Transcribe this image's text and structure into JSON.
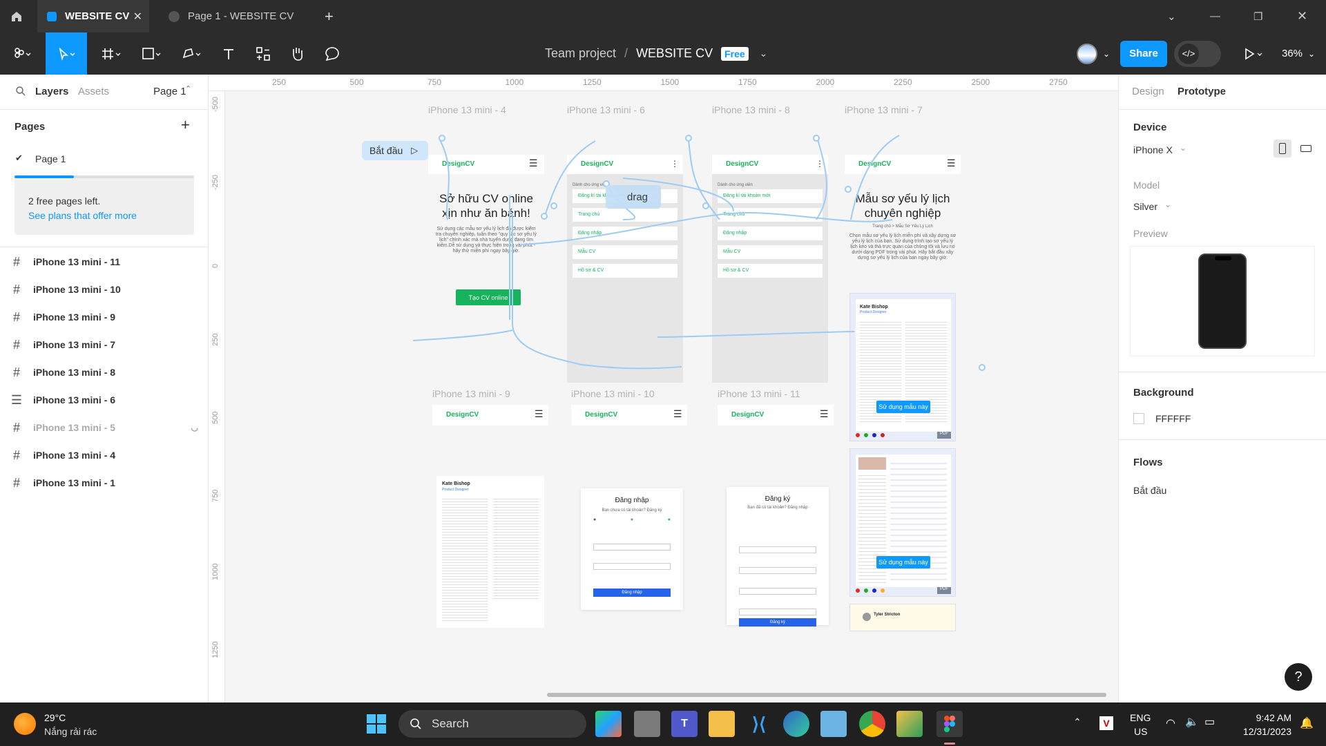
{
  "tabs": {
    "active": "WEBSITE CV",
    "inactive": "Page 1 - WEBSITE CV"
  },
  "toolbar": {
    "team": "Team project",
    "separator": "/",
    "file": "WEBSITE CV",
    "badge": "Free",
    "share": "Share",
    "zoom": "36%"
  },
  "left": {
    "tab_layers": "Layers",
    "tab_assets": "Assets",
    "page_select": "Page 1",
    "pages_title": "Pages",
    "page1": "Page 1",
    "notice": "2 free pages left.",
    "notice_link": "See plans that offer more",
    "layers": [
      "iPhone 13 mini - 11",
      "iPhone 13 mini - 10",
      "iPhone 13 mini - 9",
      "iPhone 13 mini - 7",
      "iPhone 13 mini - 8",
      "iPhone 13 mini - 6",
      "iPhone 13 mini - 5",
      "iPhone 13 mini - 4",
      "iPhone 13 mini - 1"
    ]
  },
  "ruler": {
    "h": [
      "250",
      "500",
      "750",
      "1000",
      "1250",
      "1500",
      "1750",
      "2000",
      "2250",
      "2500",
      "2750"
    ],
    "v": [
      "-500",
      "-250",
      "0",
      "250",
      "500",
      "750",
      "1000",
      "1250"
    ]
  },
  "canvas": {
    "flow_start": "Bắt đầu",
    "drag_label": "drag",
    "frames": {
      "f4": "iPhone 13 mini - 4",
      "f6": "iPhone 13 mini - 6",
      "f8": "iPhone 13 mini - 8",
      "f7": "iPhone 13 mini - 7",
      "f9": "iPhone 13 mini - 9",
      "f10": "iPhone 13 mini - 10",
      "f11": "iPhone 13 mini - 11"
    },
    "logo": "DesignCV",
    "hero_title_1": "Sở hữu CV online",
    "hero_title_2": "xịn như ăn bánh!",
    "hero_desc": "Sử dụng các mẫu sơ yếu lý lịch đã được kiểm tra chuyên nghiệp, tuân theo \"quy tắc sơ yếu lý lịch\" chính xác mà nhà tuyển dụng đang tìm kiếm.Dễ sử dụng và thực hiện trong vài phút - hãy thử miễn phí ngay bây giờ.",
    "hero_cta": "Tạo CV online",
    "menu_for": "Dành cho ứng viên",
    "menu_items": [
      "Đăng kí tài khoản mới",
      "Trang chủ",
      "Đăng nhập",
      "Mẫu CV",
      "Hồ sơ & CV"
    ],
    "tpl_title_1": "Mẫu sơ yếu lý lịch",
    "tpl_title_2": "chuyên nghiệp",
    "tpl_crumb": "Trang chủ > Mẫu Sơ Yếu Lý Lịch",
    "tpl_desc": "Chọn mẫu sơ yếu lý lịch miễn phí và xây dựng sơ yếu lý lịch của bạn. Sử dụng trình tạo sơ yếu lý lịch kéo và thả trực quan của chúng tôi và lưu nó dưới dạng PDF trong vài phút. Hãy bắt đầu xây dựng sơ yếu lý lịch của bạn ngay bây giờ.",
    "use_template": "Sử dụng mẫu này",
    "pdf": "PDF",
    "cv_name": "Kate Bishop",
    "cv_role": "Product Designer",
    "cv_name2": "Tyler Stricton",
    "login_title": "Đăng nhập",
    "login_sub": "Bạn chưa có tài khoản? Đăng ký",
    "login_btn": "Đăng nhập",
    "register_title": "Đăng ký",
    "register_sub": "Bạn đã có tài khoản? Đăng nhập",
    "register_btn": "Đăng ký"
  },
  "right": {
    "tab_design": "Design",
    "tab_prototype": "Prototype",
    "device_title": "Device",
    "device": "iPhone X",
    "model_label": "Model",
    "model": "Silver",
    "preview_label": "Preview",
    "bg_title": "Background",
    "bg_value": "FFFFFF",
    "flows_title": "Flows",
    "flow": "Bắt đầu"
  },
  "taskbar": {
    "temp": "29°C",
    "weather": "Nắng rải rác",
    "search": "Search",
    "lang1": "ENG",
    "lang2": "US",
    "time": "9:42 AM",
    "date": "12/31/2023"
  },
  "colors": {
    "accent": "#0d99ff",
    "green": "#17b25c",
    "dark": "#2c2c2c"
  }
}
